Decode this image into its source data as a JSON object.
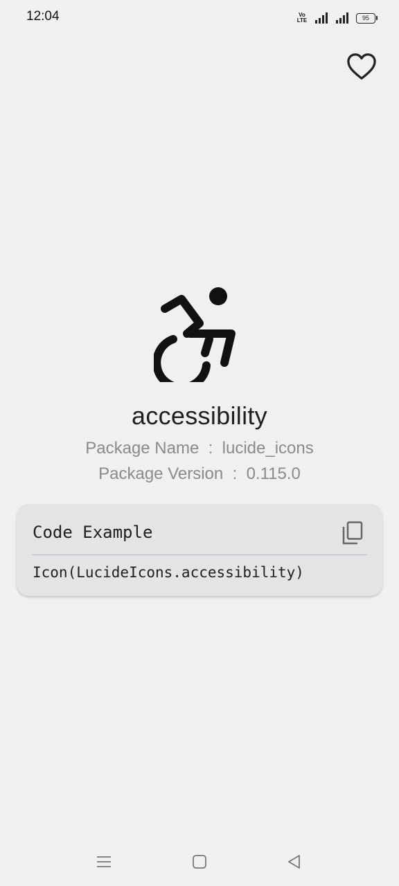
{
  "status_bar": {
    "time": "12:04",
    "volte": "Vo\nLTE",
    "battery_level": "95",
    "icons": [
      "volte-icon",
      "signal-icon",
      "signal-icon",
      "battery-icon"
    ]
  },
  "header": {
    "favorite_icon": "heart-outline-icon"
  },
  "icon_detail": {
    "icon_glyph": "accessibility-icon",
    "name": "accessibility",
    "package_name_line": "Package Name  :  lucide_icons",
    "package_version_line": "Package Version  :  0.115.0"
  },
  "code_card": {
    "title": "Code Example",
    "copy_icon": "copy-icon",
    "code": "Icon(LucideIcons.accessibility)"
  },
  "nav_bar": {
    "icons": [
      "menu-icon",
      "home-square-icon",
      "back-triangle-icon"
    ]
  },
  "colors": {
    "background": "#f0f0f0",
    "card": "#e4e4e4",
    "muted_text": "#8a8a8a",
    "divider": "#b8b8c4"
  }
}
